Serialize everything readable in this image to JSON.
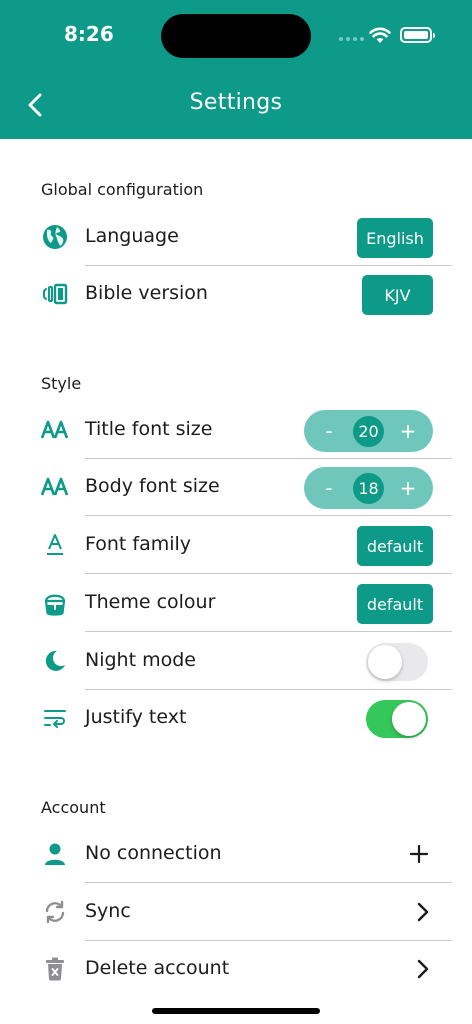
{
  "status_bar": {
    "time": "8:26"
  },
  "header": {
    "title": "Settings"
  },
  "sections": {
    "global": {
      "title": "Global configuration",
      "language": {
        "label": "Language",
        "value": "English"
      },
      "bible_version": {
        "label": "Bible version",
        "value": "KJV"
      }
    },
    "style": {
      "title": "Style",
      "title_font_size": {
        "label": "Title font size",
        "value": 20,
        "minus": "-",
        "plus": "+"
      },
      "body_font_size": {
        "label": "Body font size",
        "value": 18,
        "minus": "-",
        "plus": "+"
      },
      "font_family": {
        "label": "Font family",
        "value": "default"
      },
      "theme_colour": {
        "label": "Theme colour",
        "value": "default"
      },
      "night_mode": {
        "label": "Night mode",
        "enabled": false
      },
      "justify_text": {
        "label": "Justify text",
        "enabled": true
      }
    },
    "account": {
      "title": "Account",
      "connection": {
        "label": "No connection"
      },
      "sync": {
        "label": "Sync"
      },
      "delete": {
        "label": "Delete account"
      }
    }
  },
  "colors": {
    "accent": "#0e9a88",
    "stepper_bg": "#6fc7bc",
    "toggle_on": "#34c759",
    "toggle_off": "#e9e9eb"
  },
  "icons": {
    "back": "chevron-left-icon",
    "language": "globe-icon",
    "bible_version": "book-versions-icon",
    "title_font_size": "font-size-icon",
    "body_font_size": "font-size-icon",
    "font_family": "font-family-icon",
    "theme_colour": "paint-bucket-icon",
    "night_mode": "moon-icon",
    "justify_text": "wrap-text-icon",
    "connection": "user-icon",
    "sync": "sync-icon",
    "delete": "trash-icon"
  }
}
